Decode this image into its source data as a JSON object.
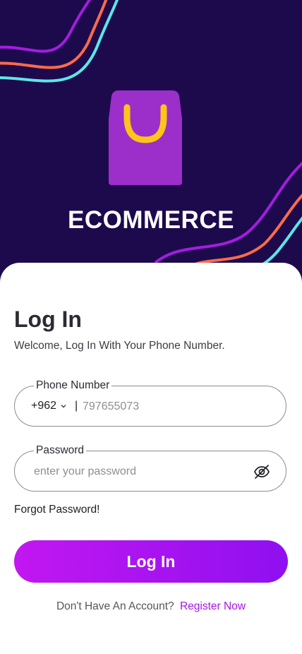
{
  "brand": {
    "name": "ECOMMERCE",
    "logo_icon": "shopping-bag-icon",
    "colors": {
      "background": "#1d0a4d",
      "bag": "#9c2ec9",
      "handle": "#ffc41a",
      "wave_purple": "#a31dde",
      "wave_orange": "#ff6b4a",
      "wave_cyan": "#5de6e6"
    }
  },
  "login": {
    "title": "Log In",
    "subtitle": "Welcome, Log In With Your Phone Number.",
    "phone": {
      "label": "Phone Number",
      "country_code": "+962",
      "separator": "|",
      "placeholder": "797655073",
      "value": ""
    },
    "password": {
      "label": "Password",
      "placeholder": "enter your password",
      "value": "",
      "toggle_icon": "eye-off-icon"
    },
    "forgot": "Forgot Password!",
    "submit": "Log In",
    "register_question": "Don't Have An Account?",
    "register_link": "Register Now",
    "accent": "#a614e6"
  }
}
